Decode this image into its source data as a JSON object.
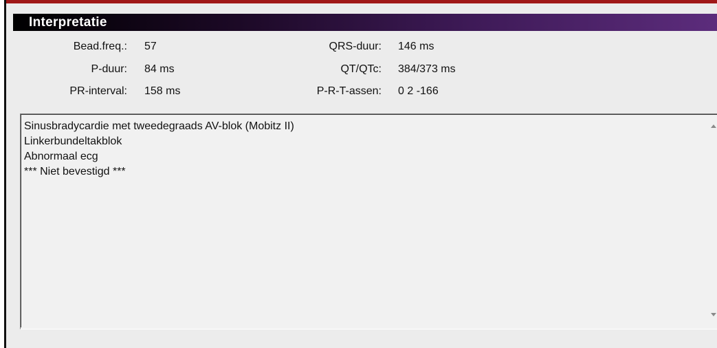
{
  "interpretation": {
    "title": "Interpretatie",
    "measurements": [
      {
        "label": "Bead.freq.:",
        "value": "57"
      },
      {
        "label": "P-duur:",
        "value": "84 ms"
      },
      {
        "label": "PR-interval:",
        "value": "158 ms"
      },
      {
        "label": "QRS-duur:",
        "value": "146 ms"
      },
      {
        "label": "QT/QTc:",
        "value": "384/373 ms"
      },
      {
        "label": "P-R-T-assen:",
        "value": "0 2 -166"
      }
    ],
    "statements": [
      "Sinusbradycardie met tweedegraads AV-blok (Mobitz II)",
      "Linkerbundeltakblok",
      "Abnormaal ecg",
      "*** Niet bevestigd ***"
    ]
  },
  "colors": {
    "title_gradient_start": "#000000",
    "title_gradient_end": "#5c2c7c",
    "top_accent": "#a01818",
    "panel_background": "#ececec"
  }
}
